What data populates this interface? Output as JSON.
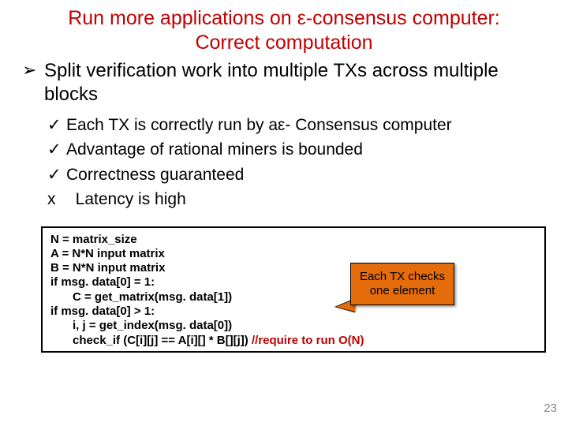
{
  "title_line1": "Run more applications on ε-consensus computer:",
  "title_line2": "Correct computation",
  "main_bullet": "Split verification work into multiple TXs across multiple blocks",
  "subs": {
    "s1": "Each TX is correctly run by aε- Consensus computer",
    "s2": "Advantage of rational miners is bounded",
    "s3": "Correctness guaranteed",
    "s4": "Latency is high"
  },
  "code": {
    "l1": "N = matrix_size",
    "l2": "A = N*N input matrix",
    "l3": "B = N*N input matrix",
    "l4": "if msg. data[0] = 1:",
    "l5": "C = get_matrix(msg. data[1])",
    "l6": "if msg. data[0] > 1:",
    "l7": "i, j = get_index(msg. data[0])",
    "l8a": "check_if (C[i][j] == A[i][] * B[][j])  ",
    "l8b": "//require to run O(N)"
  },
  "callout": "Each TX checks one element",
  "marks": {
    "arrow": "➢",
    "check": "✓",
    "x": "x"
  },
  "pagenum": "23"
}
